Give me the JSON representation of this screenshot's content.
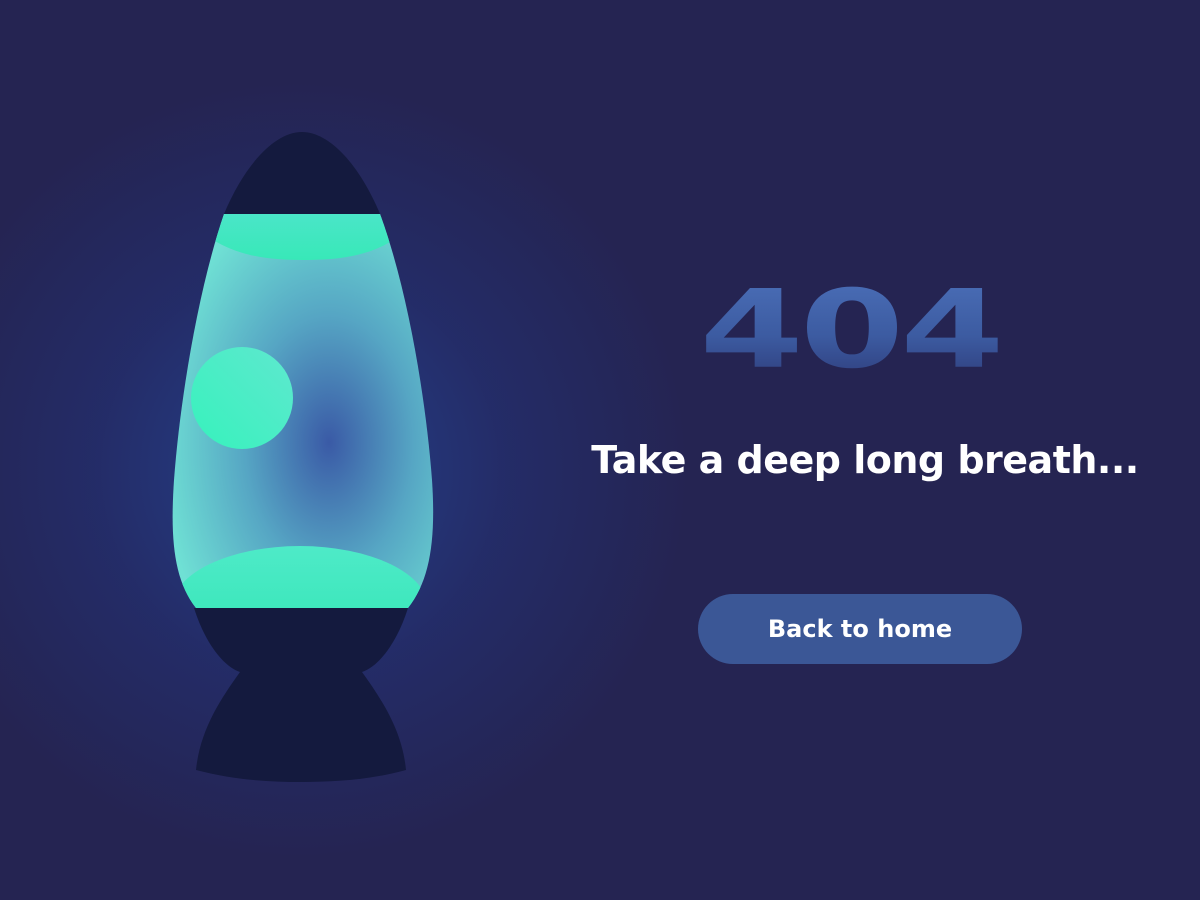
{
  "error": {
    "code": "404",
    "message": "Take a deep long breath..."
  },
  "actions": {
    "home_label": "Back to home"
  },
  "illustration": {
    "icon": "lava-lamp-icon"
  },
  "colors": {
    "background": "#252452",
    "glow": "#264696",
    "lava": "#3ef0bf",
    "liquid": "#6ed7d0",
    "lamp_body": "#141a3e",
    "code_text": "#4b6fb8",
    "button": "#3b5796",
    "text": "#ffffff"
  }
}
